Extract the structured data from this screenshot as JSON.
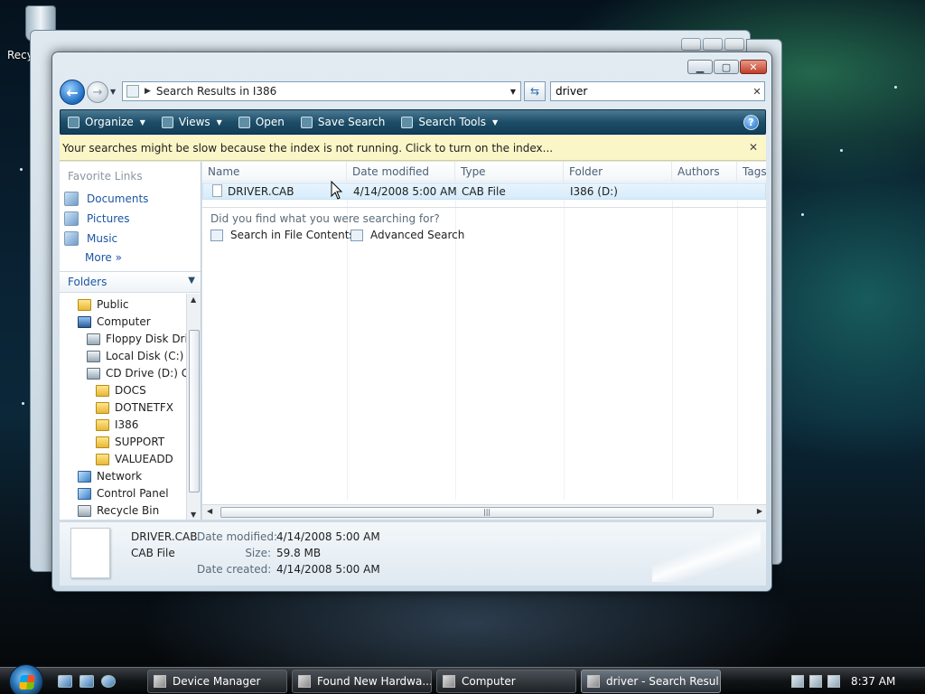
{
  "desktop": {
    "recycle_bin_label": "Recy"
  },
  "window": {
    "caption_buttons": {
      "minimize": "▁",
      "maximize": "▢",
      "close": "✕"
    },
    "address": {
      "path": "Search Results in I386"
    },
    "search": {
      "value": "driver"
    }
  },
  "command_bar": {
    "organize": "Organize",
    "views": "Views",
    "open": "Open",
    "save_search": "Save Search",
    "search_tools": "Search Tools",
    "help": "?"
  },
  "info_bar": {
    "message": "Your searches might be slow because the index is not running.  Click to turn on the index...",
    "close": "✕"
  },
  "nav_pane": {
    "favorites_title": "Favorite Links",
    "favorites": [
      "Documents",
      "Pictures",
      "Music"
    ],
    "more": "More",
    "folders_title": "Folders",
    "tree": [
      {
        "label": "Public",
        "icon": "folder-icon"
      },
      {
        "label": "Computer",
        "icon": "computer-icon"
      },
      {
        "label": "Floppy Disk Drive",
        "icon": "floppy-drive-icon"
      },
      {
        "label": "Local Disk (C:)",
        "icon": "drive-icon"
      },
      {
        "label": "CD Drive (D:) GR",
        "icon": "cd-drive-icon"
      },
      {
        "label": "DOCS",
        "icon": "folder-icon"
      },
      {
        "label": "DOTNETFX",
        "icon": "folder-icon"
      },
      {
        "label": "I386",
        "icon": "folder-icon"
      },
      {
        "label": "SUPPORT",
        "icon": "folder-icon"
      },
      {
        "label": "VALUEADD",
        "icon": "folder-icon"
      },
      {
        "label": "Network",
        "icon": "network-icon"
      },
      {
        "label": "Control Panel",
        "icon": "control-panel-icon"
      },
      {
        "label": "Recycle Bin",
        "icon": "recycle-bin-icon"
      }
    ]
  },
  "file_list": {
    "columns": [
      "Name",
      "Date modified",
      "Type",
      "Folder",
      "Authors",
      "Tags"
    ],
    "rows": [
      {
        "name": "DRIVER.CAB",
        "date_modified": "4/14/2008 5:00 AM",
        "type": "CAB File",
        "folder": "I386 (D:)"
      }
    ],
    "prompt": "Did you find what you were searching for?",
    "search_in_contents": "Search in File Contents",
    "advanced_search": "Advanced Search"
  },
  "details": {
    "name": "DRIVER.CAB",
    "type": "CAB File",
    "date_modified_label": "Date modified:",
    "date_modified": "4/14/2008 5:00 AM",
    "size_label": "Size:",
    "size": "59.8 MB",
    "date_created_label": "Date created:",
    "date_created": "4/14/2008 5:00 AM"
  },
  "taskbar": {
    "buttons": [
      "Device Manager",
      "Found New Hardwa...",
      "Computer",
      "driver - Search Resul..."
    ],
    "clock": "8:37 AM"
  },
  "colors": {
    "command_bar": "#1d4d68",
    "info_bar": "#fbf6c7",
    "link_blue": "#1b56a3",
    "selection": "#d6ecfb"
  }
}
